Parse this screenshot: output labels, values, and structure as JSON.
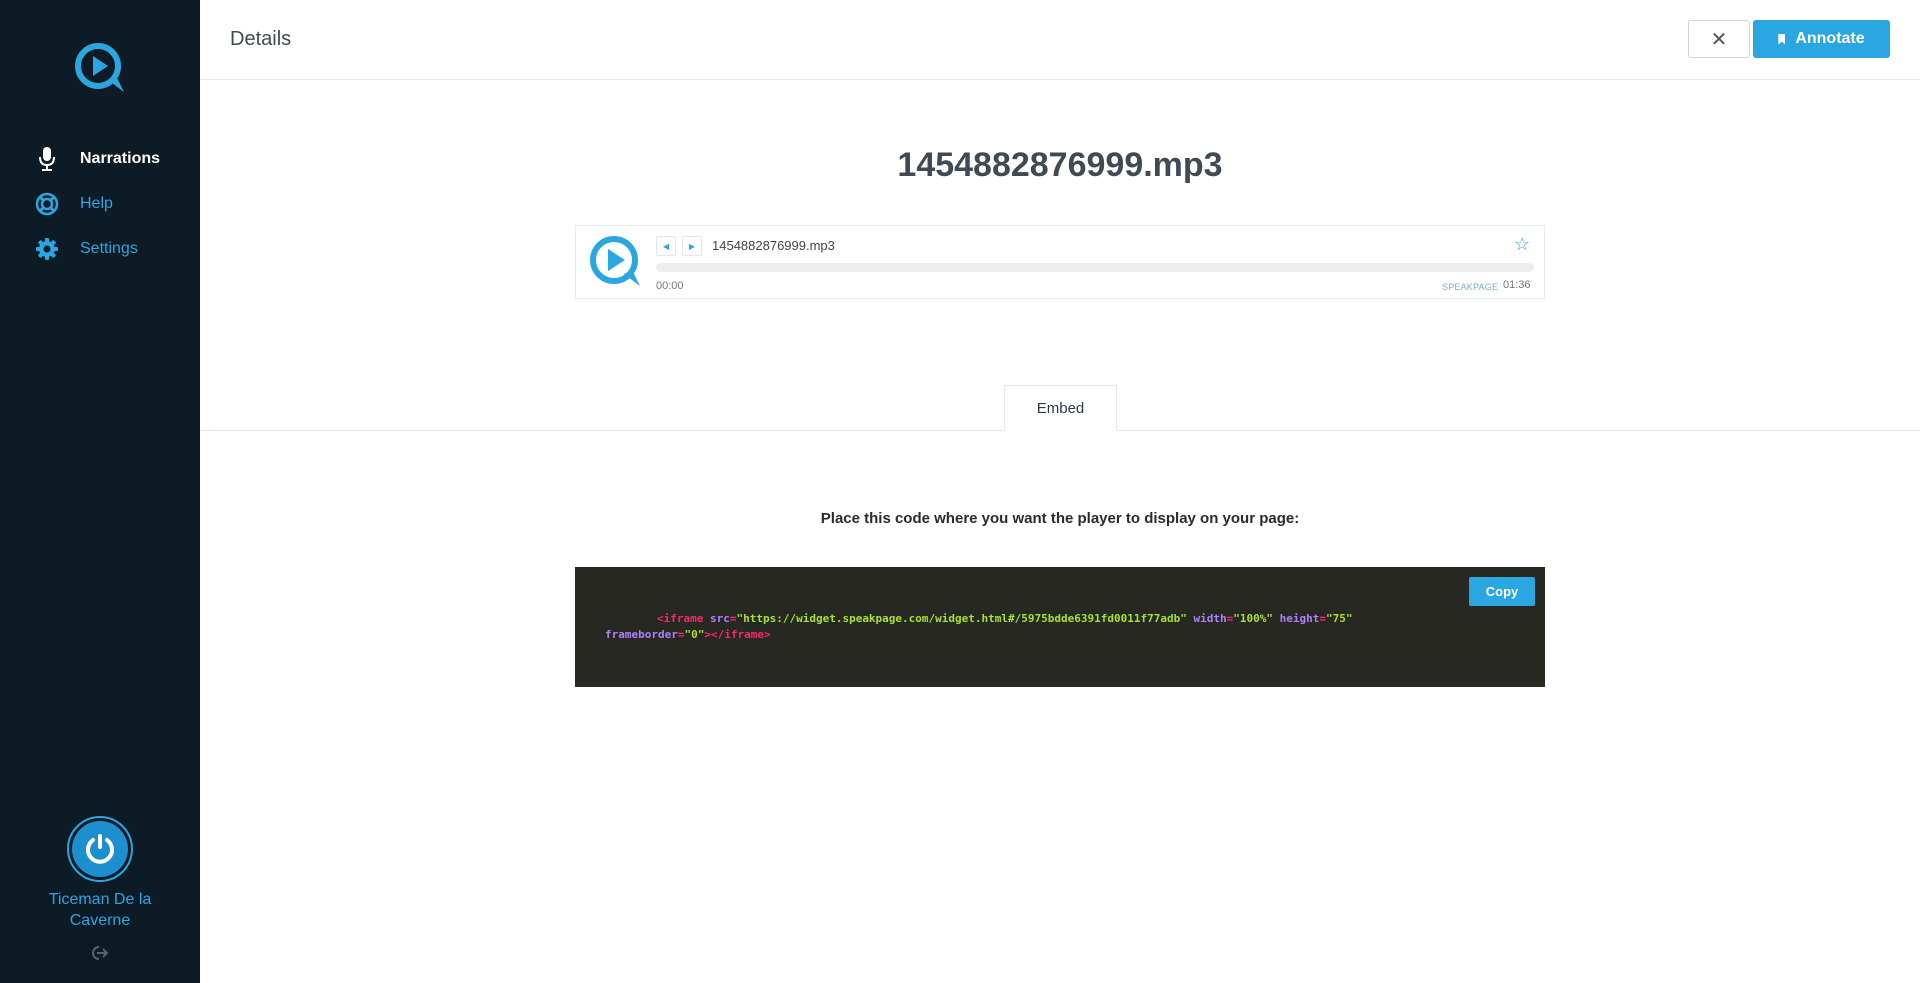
{
  "sidebar": {
    "items": [
      {
        "label": "Narrations",
        "icon": "microphone-icon",
        "active": true
      },
      {
        "label": "Help",
        "icon": "lifebuoy-icon",
        "active": false
      },
      {
        "label": "Settings",
        "icon": "gear-icon",
        "active": false
      }
    ],
    "user": {
      "name_line1": "Ticeman De la",
      "name_line2": "Caverne"
    }
  },
  "header": {
    "title": "Details",
    "close_label": "✕",
    "annotate_label": "Annotate"
  },
  "main": {
    "title": "1454882876999.mp3",
    "player": {
      "track_name": "1454882876999.mp3",
      "current_time": "00:00",
      "duration": "01:36",
      "brand": "SPEAKPAGE",
      "progress": 0
    },
    "tabs": [
      {
        "label": "Embed",
        "active": true
      }
    ],
    "instructions": "Place this code where you want the player to display on your page:",
    "code": {
      "copy_label": "Copy",
      "tag_open": "<iframe",
      "attr_src": "src",
      "eq": "=",
      "src_value": "\"https://widget.speakpage.com/widget.html#/5975bdde6391fd0011f77adb\"",
      "attr_width": "width",
      "width_value": "\"100%\"",
      "attr_height": "height",
      "height_value": "\"75\"",
      "attr_frameborder": "frameborder",
      "frameborder_value": "\"0\"",
      "tag_close": "></iframe>"
    }
  },
  "colors": {
    "sidebar_bg": "#0c1b26",
    "accent": "#2aa6e0",
    "code_bg": "#272822"
  }
}
